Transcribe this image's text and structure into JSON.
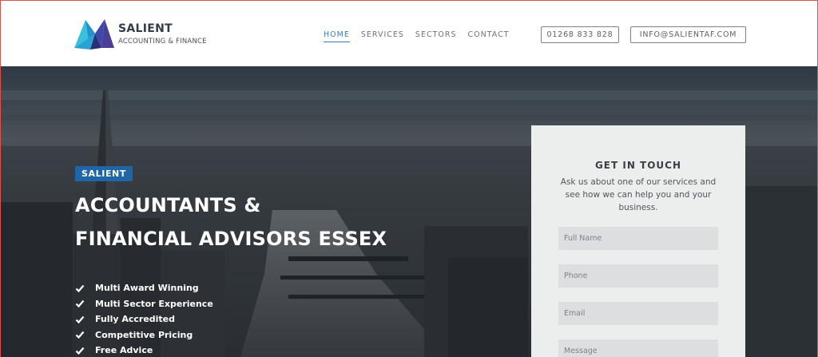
{
  "brand": {
    "name": "SALIENT",
    "subtitle": "ACCOUNTING & FINANCE",
    "colors": {
      "logo_light": "#2fb7d6",
      "logo_mid": "#2a7dc4",
      "logo_dark": "#3a2f7e"
    }
  },
  "nav": {
    "items": [
      {
        "label": "HOME",
        "active": true
      },
      {
        "label": "SERVICES",
        "active": false
      },
      {
        "label": "SECTORS",
        "active": false
      },
      {
        "label": "CONTACT",
        "active": false
      }
    ],
    "accent": "#3e7bc0"
  },
  "header_buttons": {
    "phone": "01268 833 828",
    "email": "INFO@SALIENTAF.COM"
  },
  "hero": {
    "badge": "SALIENT",
    "badge_color": "#1e66a8",
    "headline_line1": "ACCOUNTANTS &",
    "headline_line2": "FINANCIAL ADVISORS ESSEX",
    "features": [
      "Multi Award Winning",
      "Multi Sector Experience",
      "Fully Accredited",
      "Competitive Pricing",
      "Free Advice"
    ],
    "feature_icon": "check-icon"
  },
  "contact_card": {
    "title": "GET IN TOUCH",
    "text": "Ask us about one of our services and see how we can help you and your business.",
    "fields": {
      "full_name_placeholder": "Full Name",
      "phone_placeholder": "Phone",
      "email_placeholder": "Email",
      "message_placeholder": "Message"
    }
  }
}
